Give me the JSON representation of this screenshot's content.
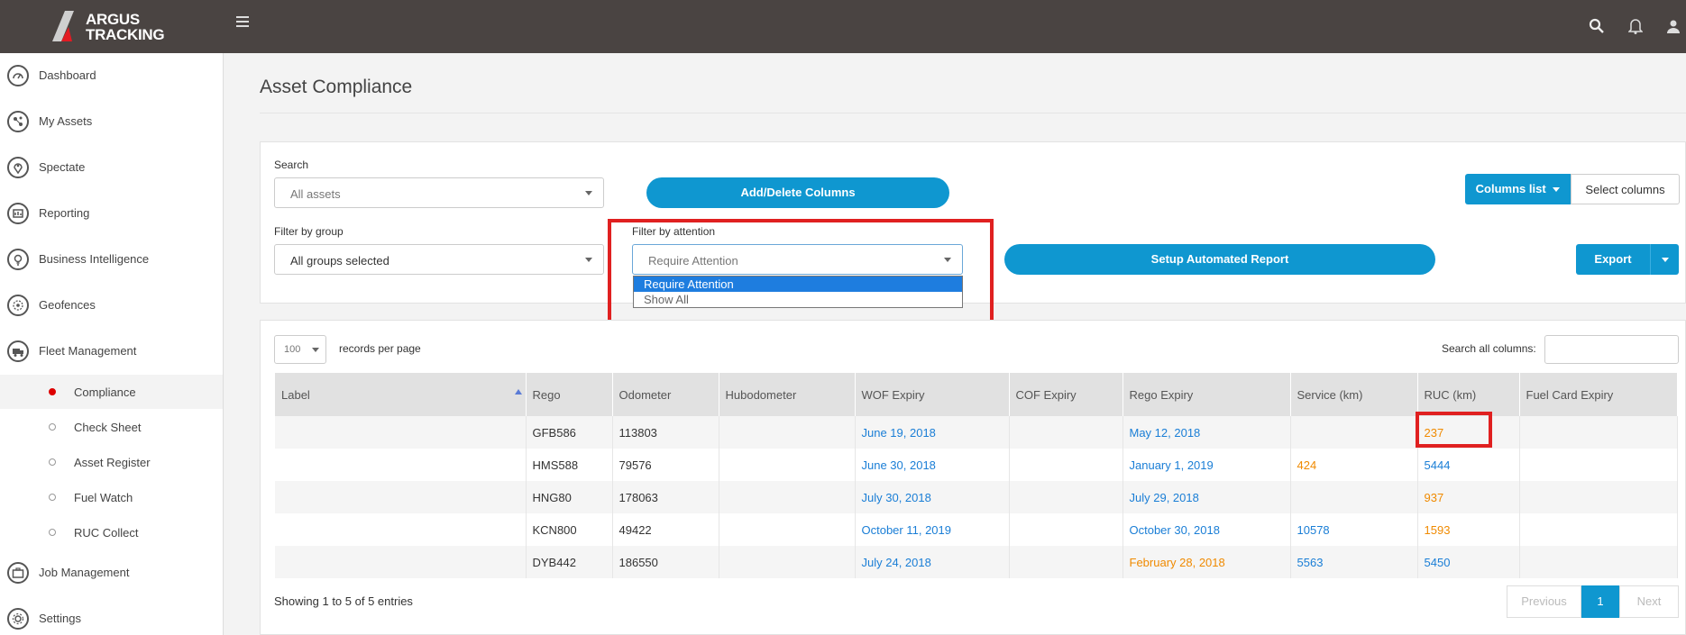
{
  "brand": {
    "line1": "ARGUS",
    "line2": "TRACKING"
  },
  "top_icons": [
    "search-icon",
    "bell-icon",
    "user-icon"
  ],
  "sidebar": {
    "items": [
      {
        "label": "Dashboard",
        "icon": "dashboard-icon"
      },
      {
        "label": "My Assets",
        "icon": "assets-icon"
      },
      {
        "label": "Spectate",
        "icon": "location-pin-icon"
      },
      {
        "label": "Reporting",
        "icon": "reporting-icon"
      },
      {
        "label": "Business Intelligence",
        "icon": "lightbulb-icon"
      },
      {
        "label": "Geofences",
        "icon": "geofence-icon"
      },
      {
        "label": "Fleet Management",
        "icon": "truck-icon"
      }
    ],
    "fleet_sub": [
      "Compliance",
      "Check Sheet",
      "Asset Register",
      "Fuel Watch",
      "RUC Collect"
    ],
    "bottom_items": [
      {
        "label": "Job Management",
        "icon": "briefcase-icon"
      },
      {
        "label": "Settings",
        "icon": "gear-icon"
      }
    ]
  },
  "page": {
    "title": "Asset Compliance"
  },
  "filters": {
    "search_label": "Search",
    "search_value": "All assets",
    "group_label": "Filter by group",
    "group_value": "All groups selected",
    "attention_label": "Filter by attention",
    "attention_value": "Require Attention",
    "attention_options": [
      "Require Attention",
      "Show All"
    ],
    "add_delete_columns": "Add/Delete Columns",
    "setup_report": "Setup Automated Report",
    "columns_list": "Columns list",
    "select_columns": "Select columns",
    "export": "Export"
  },
  "table_controls": {
    "records_per_page": "100",
    "records_label": "records per page",
    "search_all_label": "Search all columns:"
  },
  "table": {
    "columns": [
      "Label",
      "Rego",
      "Odometer",
      "Hubodometer",
      "WOF Expiry",
      "COF Expiry",
      "Rego Expiry",
      "Service (km)",
      "RUC (km)",
      "Fuel Card Expiry"
    ],
    "rows": [
      {
        "label": "",
        "rego": "GFB586",
        "odometer": "113803",
        "hubodometer": "",
        "wof": "June 19, 2018",
        "cof": "",
        "rego_expiry": "May 12, 2018",
        "service": "",
        "ruc": "237",
        "fuel": ""
      },
      {
        "label": "",
        "rego": "HMS588",
        "odometer": "79576",
        "hubodometer": "",
        "wof": "June 30, 2018",
        "cof": "",
        "rego_expiry": "January 1, 2019",
        "service": "424",
        "ruc": "5444",
        "fuel": ""
      },
      {
        "label": "",
        "rego": "HNG80",
        "odometer": "178063",
        "hubodometer": "",
        "wof": "July 30, 2018",
        "cof": "",
        "rego_expiry": "July 29, 2018",
        "service": "",
        "ruc": "937",
        "fuel": ""
      },
      {
        "label": "",
        "rego": "KCN800",
        "odometer": "49422",
        "hubodometer": "",
        "wof": "October 11, 2019",
        "cof": "",
        "rego_expiry": "October 30, 2018",
        "service": "10578",
        "ruc": "1593",
        "fuel": ""
      },
      {
        "label": "",
        "rego": "DYB442",
        "odometer": "186550",
        "hubodometer": "",
        "wof": "July 24, 2018",
        "cof": "",
        "rego_expiry": "February 28, 2018",
        "service": "5563",
        "ruc": "5450",
        "fuel": ""
      }
    ]
  },
  "footer": {
    "showing": "Showing 1 to 5 of 5 entries",
    "previous": "Previous",
    "page": "1",
    "next": "Next"
  },
  "colors": {
    "accent": "#0f97d0",
    "topbar": "#4a4442",
    "highlight": "#e02020",
    "warn": "#f08a00",
    "link": "#1a7ed6"
  }
}
